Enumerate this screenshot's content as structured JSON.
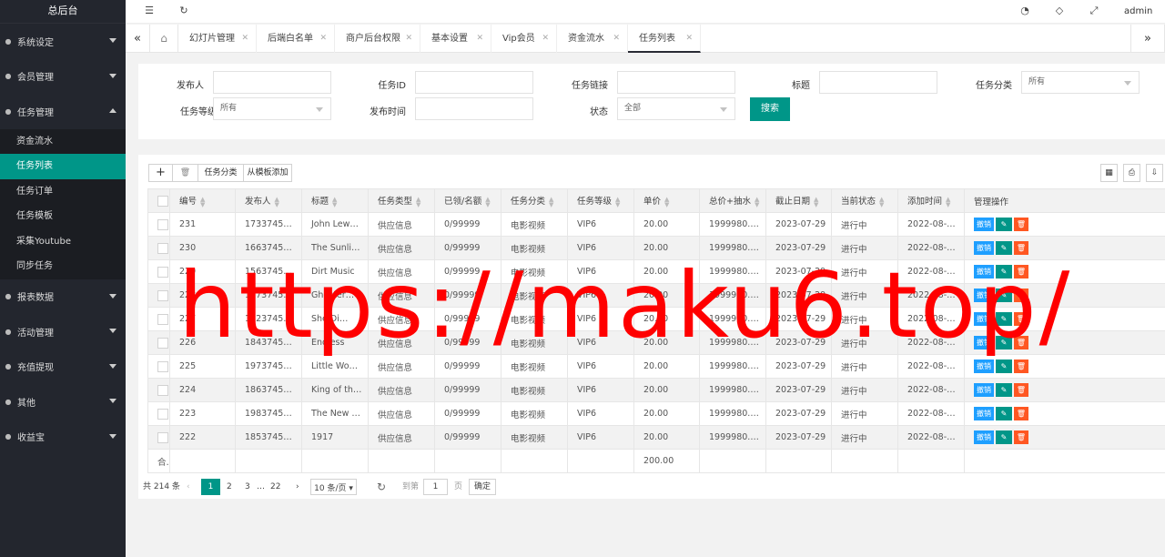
{
  "sidebar": {
    "title": "总后台",
    "menus": [
      {
        "label": "系统设定",
        "icon": "gear-icon"
      },
      {
        "label": "会员管理",
        "icon": "user-icon"
      },
      {
        "label": "任务管理",
        "icon": "list-icon"
      },
      {
        "label": "报表数据",
        "icon": "report-icon"
      },
      {
        "label": "活动管理",
        "icon": "activity-icon"
      },
      {
        "label": "充值提现",
        "icon": "money-icon"
      },
      {
        "label": "其他",
        "icon": "link-icon"
      },
      {
        "label": "收益宝",
        "icon": "wallet-icon"
      }
    ],
    "task_sub": [
      "资金流水",
      "任务列表",
      "任务订单",
      "任务模板",
      "采集Youtube",
      "同步任务"
    ],
    "active_sub": "任务列表"
  },
  "topbar": {
    "user": "admin"
  },
  "tabs": [
    "幻灯片管理",
    "后端白名单",
    "商户后台权限",
    "基本设置",
    "Vip会员",
    "资金流水",
    "任务列表"
  ],
  "active_tab": "任务列表",
  "search": {
    "publisher": "发布人",
    "task_id": "任务ID",
    "task_link": "任务链接",
    "title": "标题",
    "category": "任务分类",
    "category_value": "所有",
    "level": "任务等级",
    "level_value": "所有",
    "publish_time": "发布时间",
    "status": "状态",
    "status_value": "全部",
    "button": "搜索"
  },
  "toolbar": {
    "add": "+",
    "delete": "🗑",
    "category": "任务分类",
    "from_template": "从模板添加"
  },
  "table": {
    "columns": [
      "编号",
      "发布人",
      "标题",
      "任务类型",
      "已领/名额",
      "任务分类",
      "任务等级",
      "单价",
      "总价+抽水",
      "截止日期",
      "当前状态",
      "添加时间",
      "管理操作"
    ],
    "rows": [
      [
        "231",
        "1733745…",
        "John Lew…",
        "供应信息",
        "0/99999",
        "电影视频",
        "VIP6",
        "20.00",
        "1999980.…",
        "2023-07-29",
        "进行中",
        "2022-08-…"
      ],
      [
        "230",
        "1663745…",
        "The Sunli…",
        "供应信息",
        "0/99999",
        "电影视频",
        "VIP6",
        "20.00",
        "1999980.…",
        "2023-07-29",
        "进行中",
        "2022-08-…"
      ],
      [
        "229",
        "1563745…",
        "Dirt Music",
        "供应信息",
        "0/99999",
        "电影视频",
        "VIP6",
        "20.00",
        "1999980.…",
        "2023-07-29",
        "进行中",
        "2022-08-…"
      ],
      [
        "228",
        "1773745…",
        "Ghoster…",
        "供应信息",
        "0/99999",
        "电影视频",
        "VIP6",
        "20.00",
        "1999980.…",
        "2023-07-29",
        "进行中",
        "2022-08-…"
      ],
      [
        "227",
        "1923745…",
        "She Di…",
        "供应信息",
        "0/99999",
        "电影视频",
        "VIP6",
        "20.00",
        "1999980.…",
        "2023-07-29",
        "进行中",
        "2022-08-…"
      ],
      [
        "226",
        "1843745…",
        "Endless",
        "供应信息",
        "0/99999",
        "电影视频",
        "VIP6",
        "20.00",
        "1999980.…",
        "2023-07-29",
        "进行中",
        "2022-08-…"
      ],
      [
        "225",
        "1973745…",
        "Little Wo…",
        "供应信息",
        "0/99999",
        "电影视频",
        "VIP6",
        "20.00",
        "1999980.…",
        "2023-07-29",
        "进行中",
        "2022-08-…"
      ],
      [
        "224",
        "1863745…",
        "King of th…",
        "供应信息",
        "0/99999",
        "电影视频",
        "VIP6",
        "20.00",
        "1999980.…",
        "2023-07-29",
        "进行中",
        "2022-08-…"
      ],
      [
        "223",
        "1983745…",
        "The New …",
        "供应信息",
        "0/99999",
        "电影视频",
        "VIP6",
        "20.00",
        "1999980.…",
        "2023-07-29",
        "进行中",
        "2022-08-…"
      ],
      [
        "222",
        "1853745…",
        "1917",
        "供应信息",
        "0/99999",
        "电影视频",
        "VIP6",
        "20.00",
        "1999980.…",
        "2023-07-29",
        "进行中",
        "2022-08-…"
      ]
    ],
    "total_label": "合计",
    "total_price": "200.00",
    "actions": {
      "revoke": "撤销",
      "edit": "✎",
      "delete": "🗑"
    }
  },
  "pager": {
    "total": "共 214 条",
    "pages": [
      "1",
      "2",
      "3",
      "…",
      "22"
    ],
    "page_size": "10 条/页",
    "goto": "到第",
    "goto_value": "1",
    "page_unit": "页",
    "confirm": "确定"
  },
  "watermark": "https://maku6.top/"
}
